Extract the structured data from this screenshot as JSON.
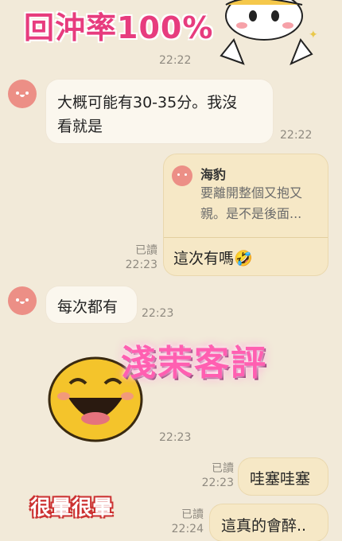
{
  "stickers": {
    "top_text": "回沖率100%",
    "watermark": "淺茉客評",
    "bottom_text": "很暈很暈"
  },
  "messages": [
    {
      "text1": "大概可能有30-35分。我沒",
      "text2": "看就是",
      "time": "22:22"
    },
    {
      "quote_name": "海豹",
      "quote_line1": "要離開整個又抱又",
      "quote_line2": "親。是不是後面...",
      "text": "這次有嗎🤣",
      "read": "已讀",
      "time": "22:23"
    },
    {
      "text": "每次都有",
      "time": "22:23"
    },
    {
      "time": "22:23"
    },
    {
      "text": "哇塞哇塞",
      "read": "已讀",
      "time": "22:23"
    },
    {
      "text": "這真的會醉..",
      "read": "已讀",
      "time": "22:24"
    }
  ],
  "top_time": "22:22",
  "colors": {
    "background": "#f2ead9",
    "incoming": "#fbf7ee",
    "outgoing": "#f6e8c6",
    "avatar": "#ec8f86"
  }
}
